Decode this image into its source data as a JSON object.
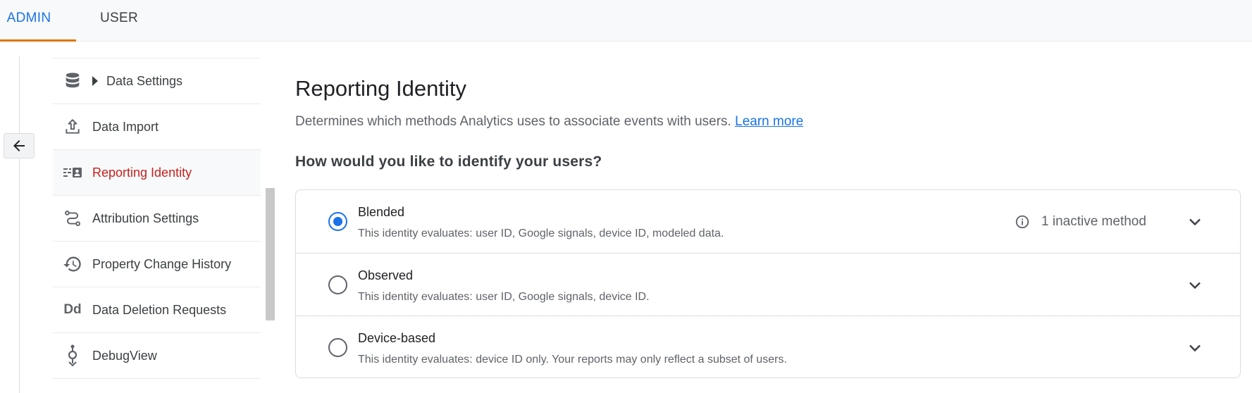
{
  "tabs": [
    {
      "label": "ADMIN",
      "active": true
    },
    {
      "label": "USER",
      "active": false
    }
  ],
  "sidebar": {
    "items": [
      {
        "label": "Data Settings",
        "icon": "database-icon",
        "expandable": true
      },
      {
        "label": "Data Import",
        "icon": "upload-icon"
      },
      {
        "label": "Reporting Identity",
        "icon": "reporting-identity-icon",
        "active": true
      },
      {
        "label": "Attribution Settings",
        "icon": "attribution-icon"
      },
      {
        "label": "Property Change History",
        "icon": "history-icon"
      },
      {
        "label": "Data Deletion Requests",
        "icon": "data-deletion-icon",
        "icon_text": "Dd"
      },
      {
        "label": "DebugView",
        "icon": "debug-icon"
      }
    ]
  },
  "main": {
    "title": "Reporting Identity",
    "description": "Determines which methods Analytics uses to associate events with users.",
    "learn_more": "Learn more",
    "question": "How would you like to identify your users?",
    "options": [
      {
        "title": "Blended",
        "subtitle": "This identity evaluates: user ID, Google signals, device ID, modeled data.",
        "selected": true,
        "status": "1 inactive method"
      },
      {
        "title": "Observed",
        "subtitle": "This identity evaluates: user ID, Google signals, device ID.",
        "selected": false
      },
      {
        "title": "Device-based",
        "subtitle": "This identity evaluates: device ID only. Your reports may only reflect a subset of users.",
        "selected": false
      }
    ]
  },
  "colors": {
    "accent": "#1a73e8",
    "tab_indicator": "#e37400",
    "active_nav": "#c5221f"
  }
}
